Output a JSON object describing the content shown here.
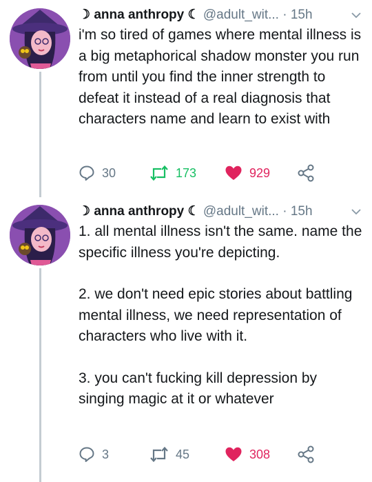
{
  "tweets": [
    {
      "display_name": "anna anthropy",
      "moon_left": "☽",
      "moon_right": "☾",
      "handle": "@adult_wit...",
      "separator": "·",
      "time": "15h",
      "paragraphs": [
        "i'm so tired of games where mental illness is a big metaphorical shadow monster you run from until you find the inner strength to defeat it instead of a real diagnosis that characters name and learn to exist with"
      ],
      "replies": "30",
      "retweets": "173",
      "likes": "929",
      "retweeted": true,
      "liked": true
    },
    {
      "display_name": "anna anthropy",
      "moon_left": "☽",
      "moon_right": "☾",
      "handle": "@adult_wit...",
      "separator": "·",
      "time": "15h",
      "paragraphs": [
        "1. all mental illness isn't the same. name the specific illness you're depicting.",
        "2. we don't need epic stories about battling mental illness, we need representation of characters who live with it.",
        "3. you can't fucking kill depression by singing magic at it or whatever"
      ],
      "replies": "3",
      "retweets": "45",
      "likes": "308",
      "retweeted": false,
      "liked": true
    }
  ],
  "colors": {
    "text": "#14171a",
    "muted": "#657786",
    "retweet_active": "#17bf63",
    "like_active": "#e0245e",
    "thread_line": "#c4ccd2",
    "avatar_bg": "#8a4fb0"
  },
  "icons": [
    "reply-icon",
    "retweet-icon",
    "heart-icon",
    "share-icon",
    "chevron-down-icon"
  ]
}
